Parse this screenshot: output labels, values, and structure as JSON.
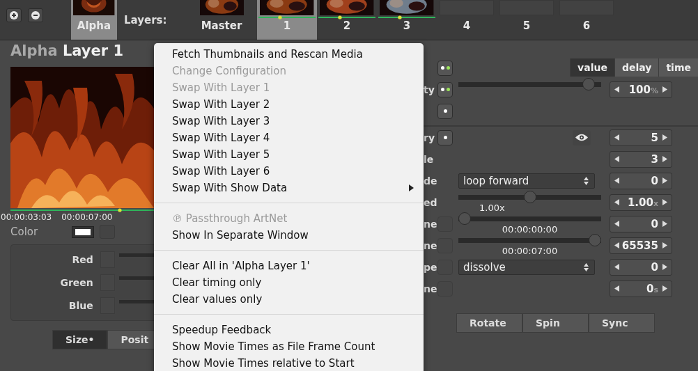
{
  "top_bar": {
    "group_tabs": [
      {
        "label": "Alpha",
        "selected": true,
        "kind": "media"
      }
    ],
    "layers_label": "Layers:",
    "layer_tabs": [
      {
        "label": "Master",
        "selected": false,
        "kind": "media"
      },
      {
        "label": "1",
        "selected": true,
        "kind": "media"
      },
      {
        "label": "2",
        "selected": false,
        "kind": "media"
      },
      {
        "label": "3",
        "selected": false,
        "kind": "media"
      },
      {
        "label": "4",
        "selected": false,
        "kind": "empty"
      },
      {
        "label": "5",
        "selected": false,
        "kind": "empty"
      },
      {
        "label": "6",
        "selected": false,
        "kind": "empty"
      }
    ]
  },
  "layer": {
    "title_prefix": "Alpha",
    "title": "Layer 1",
    "time_start": "00:00:03:03",
    "time_end": "00:00:07:00",
    "color_label": "Color",
    "channels": [
      {
        "name": "Red"
      },
      {
        "name": "Green"
      },
      {
        "name": "Blue"
      }
    ],
    "tabs": [
      {
        "label": "Size•",
        "selected": true
      },
      {
        "label": "Posit",
        "selected": false
      }
    ]
  },
  "properties": {
    "modes": [
      {
        "label": "value",
        "selected": true
      },
      {
        "label": "delay",
        "selected": false
      },
      {
        "label": "time",
        "selected": false
      }
    ],
    "rows": [
      {
        "label": "",
        "toggle": {
          "kind": "double"
        }
      },
      {
        "label": "ty",
        "toggle": {
          "kind": "double"
        },
        "kind": "slider",
        "level": 0.95,
        "value": "100",
        "unit": "%"
      },
      {
        "label": "",
        "toggle": {
          "kind": "single"
        }
      },
      {
        "label": "ry",
        "toggle": {
          "kind": "single"
        },
        "kind": "eye",
        "value": "5"
      },
      {
        "label": "le",
        "value": "3"
      },
      {
        "label": "de",
        "kind": "dropdown",
        "text": "loop forward",
        "value": "0"
      },
      {
        "label": "ed",
        "kind": "slider",
        "level": 0.5,
        "caption": "1.00x",
        "value": "1.00",
        "unit": "x"
      },
      {
        "label": "ne",
        "toggle": {
          "kind": "blank"
        },
        "kind": "slider",
        "level": 0,
        "caption": "00:00:00:00",
        "value": "0"
      },
      {
        "label": "ne",
        "toggle": {
          "kind": "blank"
        },
        "kind": "slider",
        "level": 1,
        "caption": "00:00:07:00",
        "value": "65535"
      },
      {
        "label": "pe",
        "toggle": {
          "kind": "blank"
        },
        "kind": "dropdown",
        "text": "dissolve",
        "value": "0"
      },
      {
        "label": "ne",
        "toggle": {
          "kind": "blank"
        },
        "value": "0",
        "unit": "s"
      }
    ],
    "tabs": [
      {
        "label": "Rotate",
        "selected": false
      },
      {
        "label": "Spin",
        "selected": false
      },
      {
        "label": "Sync",
        "selected": false
      }
    ]
  },
  "context_menu": [
    {
      "kind": "item",
      "label": "Fetch Thumbnails and Rescan Media",
      "disabled": false
    },
    {
      "kind": "item",
      "label": "Change Configuration",
      "disabled": true
    },
    {
      "kind": "item",
      "label": "Swap With Layer 1",
      "disabled": true
    },
    {
      "kind": "item",
      "label": "Swap With Layer 2",
      "disabled": false
    },
    {
      "kind": "item",
      "label": "Swap With Layer 3",
      "disabled": false
    },
    {
      "kind": "item",
      "label": "Swap With Layer 4",
      "disabled": false
    },
    {
      "kind": "item",
      "label": "Swap With Layer 5",
      "disabled": false
    },
    {
      "kind": "item",
      "label": "Swap With Layer 6",
      "disabled": false
    },
    {
      "kind": "item",
      "label": "Swap With Show Data",
      "disabled": false,
      "submenu": true
    },
    {
      "kind": "separator"
    },
    {
      "kind": "item",
      "label": "℗ Passthrough ArtNet",
      "disabled": true
    },
    {
      "kind": "item",
      "label": "Show In Separate Window",
      "disabled": false
    },
    {
      "kind": "separator"
    },
    {
      "kind": "item",
      "label": "Clear All in 'Alpha Layer 1'",
      "disabled": false
    },
    {
      "kind": "item",
      "label": "Clear timing only",
      "disabled": false
    },
    {
      "kind": "item",
      "label": "Clear values only",
      "disabled": false
    },
    {
      "kind": "separator"
    },
    {
      "kind": "item",
      "label": "Speedup Feedback",
      "disabled": false
    },
    {
      "kind": "item",
      "label": "Show Movie Times as File Frame Count",
      "disabled": false
    },
    {
      "kind": "item",
      "label": "Show Movie Times relative to Start",
      "disabled": false
    }
  ]
}
